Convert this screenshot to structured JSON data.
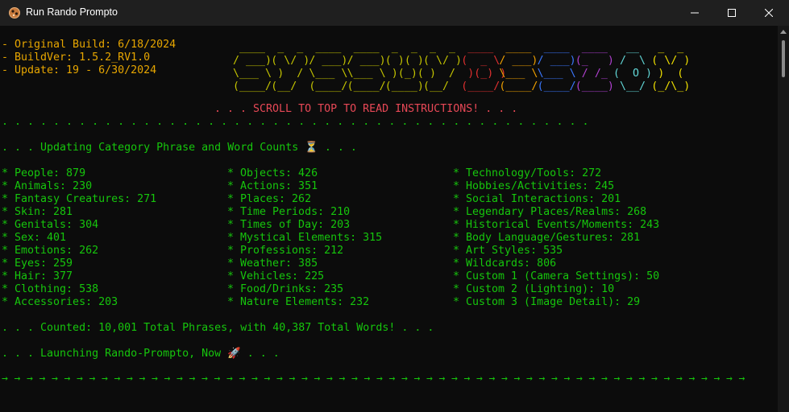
{
  "window": {
    "title": "Run Rando Prompto",
    "icon": "app-icon",
    "controls": [
      "minimize-icon",
      "maximize-icon",
      "close-icon"
    ]
  },
  "colors": {
    "orange": "#e7a600",
    "green": "#16c60c",
    "red": "#e74856",
    "banner_green": "#c4c400",
    "banner_yellow": "#f0e000",
    "banner_red": "#e03030",
    "banner_blue": "#3b78ff",
    "banner_purple": "#b040d0",
    "banner_cyan": "#61d6d6",
    "banner_orange": "#f0a000"
  },
  "header_info": [
    "- Original Build: 6/18/2024",
    "- BuildVer: 1.5.2_RV1.0",
    "- Update: 19 - 6/30/2024"
  ],
  "banner_words": [
    {
      "name": "banner-letter-S1",
      "color": "#c4c400",
      "lines": [
        " ____ ",
        "/ ___)",
        "\\___ \\",
        "(____/"
      ]
    },
    {
      "name": "banner-letter-Y",
      "color": "#c4c400",
      "lines": [
        " _  _ ",
        "( \\/ )",
        " )  / ",
        "(__/  "
      ]
    },
    {
      "name": "banner-letter-S2",
      "color": "#c4c400",
      "lines": [
        " ____ ",
        "/ ___)",
        "\\___ \\",
        "(____/"
      ]
    },
    {
      "name": "banner-letter-S3",
      "color": "#c4c400",
      "lines": [
        " ____ ",
        "/ ___)",
        "\\___ \\",
        "(____/"
      ]
    },
    {
      "name": "banner-letter-U",
      "color": "#c4c400",
      "lines": [
        " _  _ ",
        "( )( )",
        " )(_)(",
        "(____)"
      ]
    },
    {
      "name": "banner-letter-Y2",
      "color": "#c4c400",
      "lines": [
        " _  _ ",
        "( \\/ )",
        " )  / ",
        "(__/  "
      ]
    },
    {
      "name": "banner-letter-D",
      "color": "#e03030",
      "lines": [
        " ____ ",
        "(  _ \\",
        " )(_) )",
        "(____/ "
      ]
    },
    {
      "name": "banner-letter-S4",
      "color": "#f0a000",
      "lines": [
        " ____ ",
        "/ ___)",
        "\\___ \\",
        "(____/"
      ]
    },
    {
      "name": "banner-letter-S5",
      "color": "#3b78ff",
      "lines": [
        " ____ ",
        "/ ___)",
        "\\___ \\",
        "(____/"
      ]
    },
    {
      "name": "banner-letter-Z",
      "color": "#b040d0",
      "lines": [
        " ____ ",
        "(_   )",
        " / /_ ",
        "(____)"
      ]
    },
    {
      "name": "banner-letter-O",
      "color": "#61d6d6",
      "lines": [
        "  __  ",
        " /  \\ ",
        "(  O )",
        " \\__/ "
      ]
    },
    {
      "name": "banner-letter-X",
      "color": "#f0e000",
      "lines": [
        " _  _ ",
        "( \\/ )",
        " )  ( ",
        "(_/\\_)"
      ]
    }
  ],
  "scroll_notice": ". . . SCROLL TO TOP TO READ INSTRUCTIONS! . . .",
  "dots_line": ". . . . . . . . . . . . . . . . . . . . . . . . . . . . . . . . . . . . . . . . . . . . . .",
  "updating_line": ". . . Updating Category Phrase and Word Counts ⏳ . . .",
  "categories": {
    "col1": [
      "* People: 879",
      "* Animals: 230",
      "* Fantasy Creatures: 271",
      "* Skin: 281",
      "* Genitals: 304",
      "* Sex: 401",
      "* Emotions: 262",
      "* Eyes: 259",
      "* Hair: 377",
      "* Clothing: 538",
      "* Accessories: 203"
    ],
    "col2": [
      "* Objects: 426",
      "* Actions: 351",
      "* Places: 262",
      "* Time Periods: 210",
      "* Times of Day: 203",
      "* Mystical Elements: 315",
      "* Professions: 212",
      "* Weather: 385",
      "* Vehicles: 225",
      "* Food/Drinks: 235",
      "* Nature Elements: 232"
    ],
    "col3": [
      "* Technology/Tools: 272",
      "* Hobbies/Activities: 245",
      "* Social Interactions: 201",
      "* Legendary Places/Realms: 268",
      "* Historical Events/Moments: 243",
      "* Body Language/Gestures: 281",
      "* Art Styles: 535",
      "* Wildcards: 806",
      "* Custom 1 (Camera Settings): 50",
      "* Custom 2 (Lighting): 10",
      "* Custom 3 (Image Detail): 29"
    ]
  },
  "counted_line": ". . . Counted: 10,001 Total Phrases, with 40,387 Total Words! . . .",
  "launching_line": ". . . Launching Rando-Prompto, Now 🚀 . . .",
  "arrow_row": {
    "glyph": "→",
    "count": 60
  }
}
